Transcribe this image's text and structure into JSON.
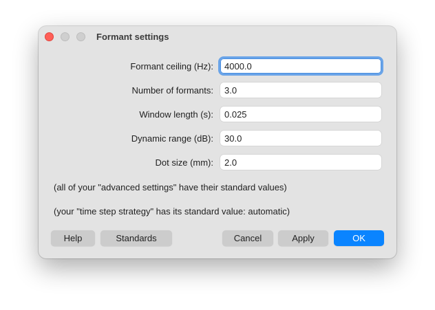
{
  "window": {
    "title": "Formant settings"
  },
  "fields": [
    {
      "label": "Formant ceiling (Hz):",
      "value": "4000.0"
    },
    {
      "label": "Number of formants:",
      "value": "3.0"
    },
    {
      "label": "Window length (s):",
      "value": "0.025"
    },
    {
      "label": "Dynamic range (dB):",
      "value": "30.0"
    },
    {
      "label": "Dot size (mm):",
      "value": "2.0"
    }
  ],
  "notes": [
    "(all of your \"advanced settings\" have their standard values)",
    "(your \"time step strategy\" has its standard value: automatic)"
  ],
  "buttons": {
    "help": "Help",
    "standards": "Standards",
    "cancel": "Cancel",
    "apply": "Apply",
    "ok": "OK"
  },
  "colors": {
    "window_background": "#e3e3e3",
    "close_light": "#ff5f57",
    "primary_button": "#0a84ff",
    "focus_ring": "#6aa4e8"
  }
}
